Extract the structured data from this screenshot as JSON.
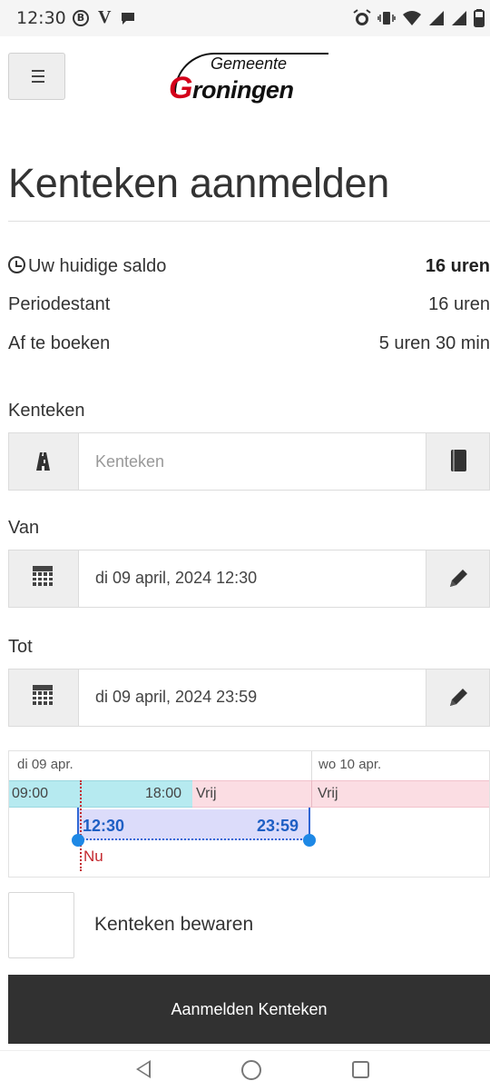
{
  "status_bar": {
    "time": "12:30",
    "left_icons": [
      "b-circle-icon",
      "v-icon",
      "chat-icon"
    ],
    "right_icons": [
      "alarm-icon",
      "vibrate-icon",
      "wifi-icon",
      "signal-icon",
      "signal-icon",
      "battery-icon"
    ]
  },
  "header": {
    "menu_icon": "hamburger-icon",
    "logo_top": "Gemeente",
    "logo_initial": "G",
    "logo_rest": "roningen"
  },
  "page": {
    "title": "Kenteken aanmelden"
  },
  "saldo": {
    "current_label": "Uw huidige saldo",
    "current_value": "16 uren",
    "period_label": "Periodestant",
    "period_value": "16 uren",
    "book_label": "Af te boeken",
    "book_value": "5 uren 30 min"
  },
  "form": {
    "kenteken_label": "Kenteken",
    "kenteken_placeholder": "Kenteken",
    "kenteken_value": "",
    "van_label": "Van",
    "van_value": "di 09 april, 2024 12:30",
    "tot_label": "Tot",
    "tot_value": "di 09 april, 2024 23:59",
    "save_label": "Kenteken bewaren",
    "submit_label": "Aanmelden Kenteken"
  },
  "timeline": {
    "day1": "di 09 apr.",
    "day2": "wo 10 apr.",
    "paid_start": "09:00",
    "paid_end": "18:00",
    "free1": "Vrij",
    "free2": "Vrij",
    "sel_start": "12:30",
    "sel_end": "23:59",
    "now": "Nu"
  },
  "colors": {
    "paid": "#b6eaf0",
    "free": "#fbdde3",
    "selection": "#dcdcfa",
    "selection_accent": "#1e88e5",
    "now": "#c4282e",
    "submit_bg": "#313131",
    "logo_red": "#d4001a"
  }
}
